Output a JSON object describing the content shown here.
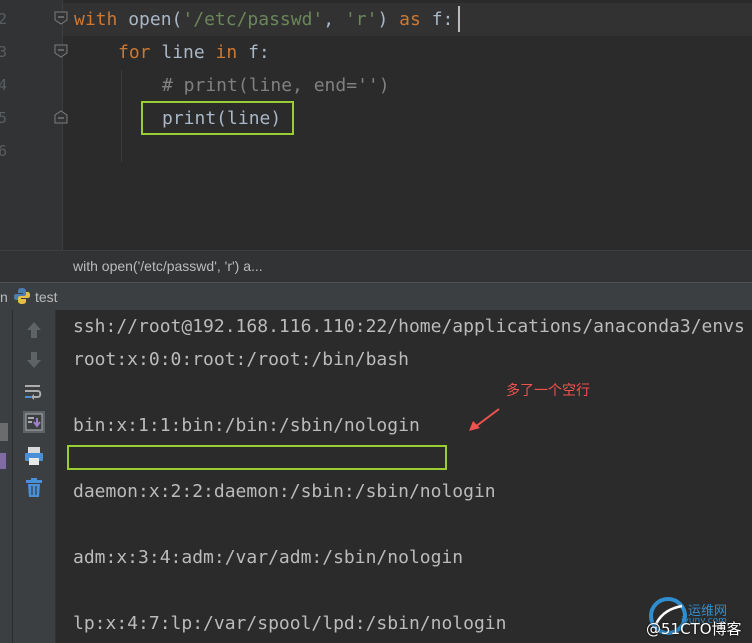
{
  "editor": {
    "line_numbers": [
      "2",
      "3",
      "4",
      "5",
      "6"
    ],
    "line1": {
      "kw_with": "with",
      "open": " open(",
      "path": "'/etc/passwd'",
      "comma": ", ",
      "mode": "'r'",
      "close": ") ",
      "kw_as": "as",
      "var": " f:"
    },
    "line2": {
      "kw_for": "for",
      "mid": " line ",
      "kw_in": "in",
      "tail": " f:"
    },
    "line3": {
      "comment": "# print(line, end='')"
    },
    "line4": {
      "call": "print(line)"
    }
  },
  "breadcrumb": {
    "text": "with open('/etc/passwd', 'r') a..."
  },
  "run_panel": {
    "prefix": "n",
    "tab_label": "test"
  },
  "console": {
    "lines": [
      "ssh://root@192.168.116.110:22/home/applications/anaconda3/envs",
      "root:x:0:0:root:/root:/bin/bash",
      "bin:x:1:1:bin:/bin:/sbin/nologin",
      "daemon:x:2:2:daemon:/sbin:/sbin/nologin",
      "adm:x:3:4:adm:/var/adm:/sbin/nologin",
      "lp:x:4:7:lp:/var/spool/lpd:/sbin/nologin"
    ]
  },
  "annotation": {
    "text": "多了一个空行"
  },
  "watermark": {
    "brand": "运维网",
    "site": "iyunv.com",
    "blog": "@51CTO博客"
  },
  "colors": {
    "highlight_box": "#9acd32",
    "annotation": "#f0534f",
    "keyword": "#cc7832",
    "string": "#6a8759",
    "comment": "#808080"
  },
  "icons": [
    "up-arrow-icon",
    "down-arrow-icon",
    "soft-wrap-icon",
    "scroll-to-end-icon",
    "print-icon",
    "trash-icon",
    "python-file-icon"
  ]
}
